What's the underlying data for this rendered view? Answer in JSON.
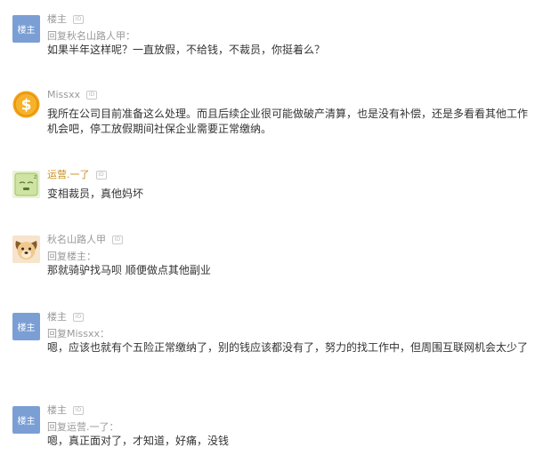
{
  "comments": [
    {
      "avatar_text": "楼主",
      "username": "楼主",
      "badge": "ID",
      "reply": "回复秋名山路人甲：",
      "content": "如果半年这样呢？一直放假，不给钱，不裁员，你挺着么？"
    },
    {
      "avatar_icon": "dollar-coin-icon",
      "username": "Missxx",
      "badge": "ID",
      "content": "我所在公司目前准备这么处理。而且后续企业很可能做破产清算，也是没有补偿，还是多看看其他工作机会吧，停工放假期间社保企业需要正常缴纳。"
    },
    {
      "avatar_icon": "sleeping-face-icon",
      "username": "运营.一了",
      "username_color": "#ca8f1a",
      "badge": "ID",
      "content": "变相裁员，真他妈坏"
    },
    {
      "avatar_icon": "dog-face-icon",
      "username": "秋名山路人甲",
      "badge": "ID",
      "reply": "回复楼主：",
      "content": "那就骑驴找马呗 顺便做点其他副业"
    },
    {
      "avatar_text": "楼主",
      "username": "楼主",
      "badge": "ID",
      "reply": "回复Missxx：",
      "content": "嗯，应该也就有个五险正常缴纳了，别的钱应该都没有了，努力的找工作中，但周围互联网机会太少了"
    },
    {
      "avatar_text": "楼主",
      "username": "楼主",
      "badge": "ID",
      "reply": "回复运营.一了：",
      "content": "嗯，真正面对了，才知道，好痛，没钱"
    }
  ]
}
